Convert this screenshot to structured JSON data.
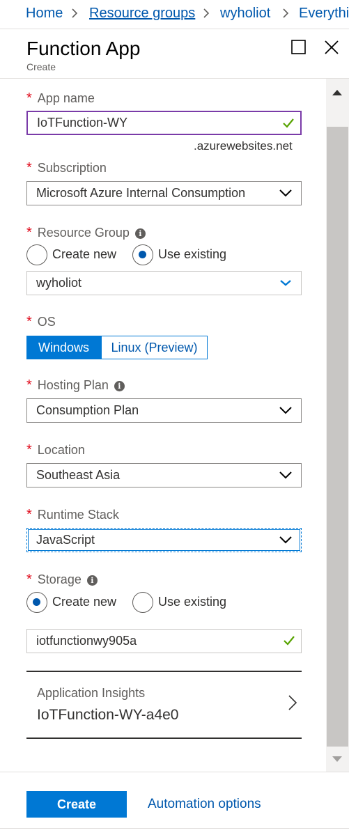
{
  "breadcrumb": {
    "items": [
      {
        "label": "Home"
      },
      {
        "label": "Resource groups"
      },
      {
        "label": "wyholiot"
      },
      {
        "label": "Everythi"
      }
    ]
  },
  "blade": {
    "title": "Function App",
    "subtitle": "Create"
  },
  "form": {
    "app_name": {
      "label": "App name",
      "value": "IoTFunction-WY",
      "suffix": ".azurewebsites.net"
    },
    "subscription": {
      "label": "Subscription",
      "value": "Microsoft Azure Internal Consumption"
    },
    "resource_group": {
      "label": "Resource Group",
      "option_new": "Create new",
      "option_existing": "Use existing",
      "selected": "Use existing",
      "value": "wyholiot"
    },
    "os": {
      "label": "OS",
      "options": [
        "Windows",
        "Linux (Preview)"
      ],
      "selected": "Windows"
    },
    "hosting_plan": {
      "label": "Hosting Plan",
      "value": "Consumption Plan"
    },
    "location": {
      "label": "Location",
      "value": "Southeast Asia"
    },
    "runtime_stack": {
      "label": "Runtime Stack",
      "value": "JavaScript"
    },
    "storage": {
      "label": "Storage",
      "option_new": "Create new",
      "option_existing": "Use existing",
      "selected": "Create new",
      "value": "iotfunctionwy905a"
    },
    "app_insights": {
      "label": "Application Insights",
      "value": "IoTFunction-WY-a4e0"
    }
  },
  "footer": {
    "create_label": "Create",
    "automation_label": "Automation options"
  },
  "colors": {
    "accent": "#0078d4",
    "link": "#0058ad",
    "required": "#e00b1c",
    "valid_check": "#57a300",
    "valid_border": "#7a3ba8"
  }
}
